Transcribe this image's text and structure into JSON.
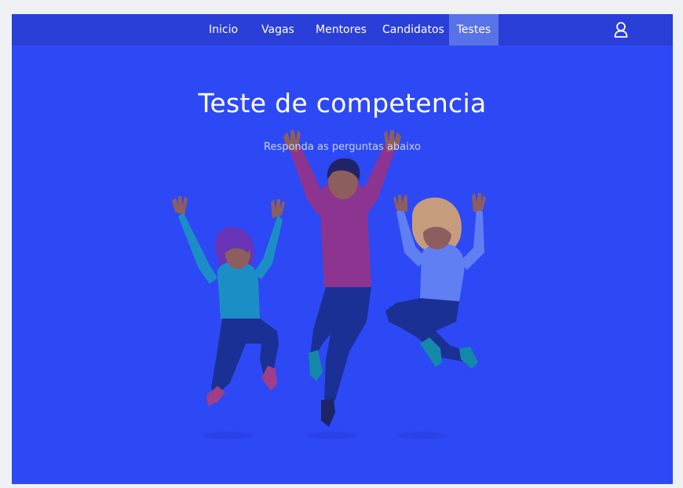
{
  "nav": {
    "links": [
      {
        "label": "Inicio"
      },
      {
        "label": "Vagas"
      },
      {
        "label": "Mentores"
      },
      {
        "label": "Candidatos"
      },
      {
        "label": "Testes",
        "active": true
      }
    ],
    "user_icon": "user-icon"
  },
  "hero": {
    "title": "Teste de competencia",
    "subtitle": "Responda as perguntas abaixo"
  },
  "colors": {
    "background": "#2d4af5",
    "navbar": "#2a3ed8",
    "active_tab": "#5a72e8"
  }
}
